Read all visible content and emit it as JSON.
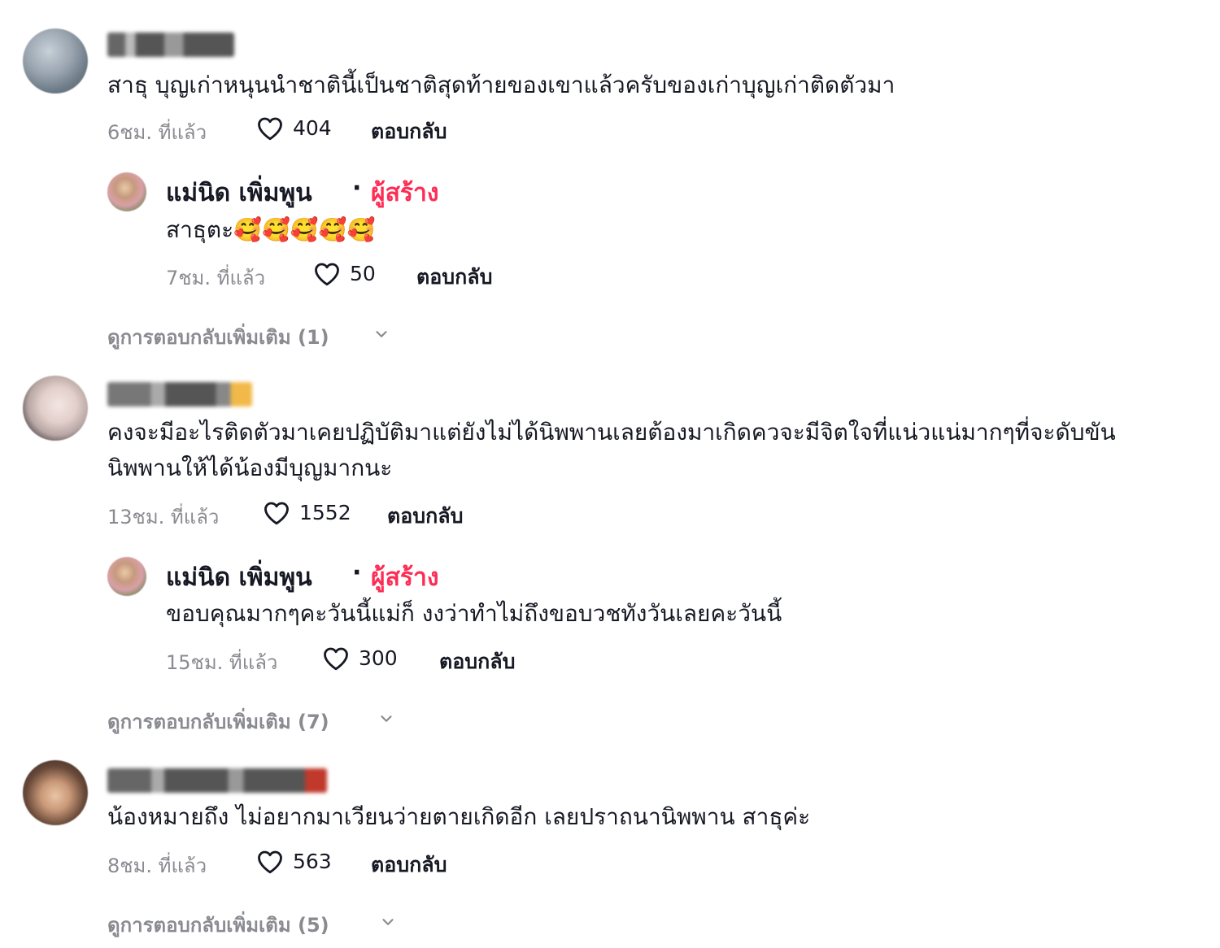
{
  "comments": [
    {
      "text_lines": [
        "สาธุ บุญเก่าหนุนนำชาตินี้เป็นชาติสุดท้ายของเขาแล้วครับของเก่าบุญเก่าติดตัวมา"
      ],
      "time": "6ชม. ที่แล้ว",
      "likes": "404",
      "reply_label": "ตอบกลับ",
      "reply": {
        "name": "แม่นิด เพิ่มพูน",
        "separator": "·",
        "badge": "ผู้สร้าง",
        "text": "สาธุตะ🥰🥰🥰🥰🥰",
        "time": "7ชม. ที่แล้ว",
        "likes": "50",
        "reply_label": "ตอบกลับ"
      },
      "more_replies": "ดูการตอบกลับเพิ่มเติม (1)"
    },
    {
      "text_lines": [
        "คงจะมีอะไรติดตัวมาเคยปฏิบัติมาแต่ยังไม่ได้นิพพานเลยต้องมาเกิดควจะมีจิตใจที่แน่วแน่มากๆที่จะดับขัน",
        "นิพพานให้ได้น้องมีบุญมากนะ"
      ],
      "time": "13ชม. ที่แล้ว",
      "likes": "1552",
      "reply_label": "ตอบกลับ",
      "reply": {
        "name": "แม่นิด เพิ่มพูน",
        "separator": "·",
        "badge": "ผู้สร้าง",
        "text": "ขอบคุณมากๆคะวันนี้แม่ก็ งงว่าทำไม่ถึงขอบวชทังวันเลยคะวันนี้",
        "time": "15ชม. ที่แล้ว",
        "likes": "300",
        "reply_label": "ตอบกลับ"
      },
      "more_replies": "ดูการตอบกลับเพิ่มเติม (7)"
    },
    {
      "text_lines": [
        "น้องหมายถึง ไม่อยากมาเวียนว่ายตายเกิดอีก เลยปราถนานิพพาน สาธุค่ะ"
      ],
      "time": "8ชม. ที่แล้ว",
      "likes": "563",
      "reply_label": "ตอบกลับ",
      "more_replies": "ดูการตอบกลับเพิ่มเติม (5)"
    }
  ],
  "colors": {
    "text": "#161823",
    "muted": "#8a8b91",
    "creator_badge": "#fe2c55"
  },
  "icons": {
    "like": "heart-outline-icon",
    "expand": "chevron-down-icon"
  }
}
